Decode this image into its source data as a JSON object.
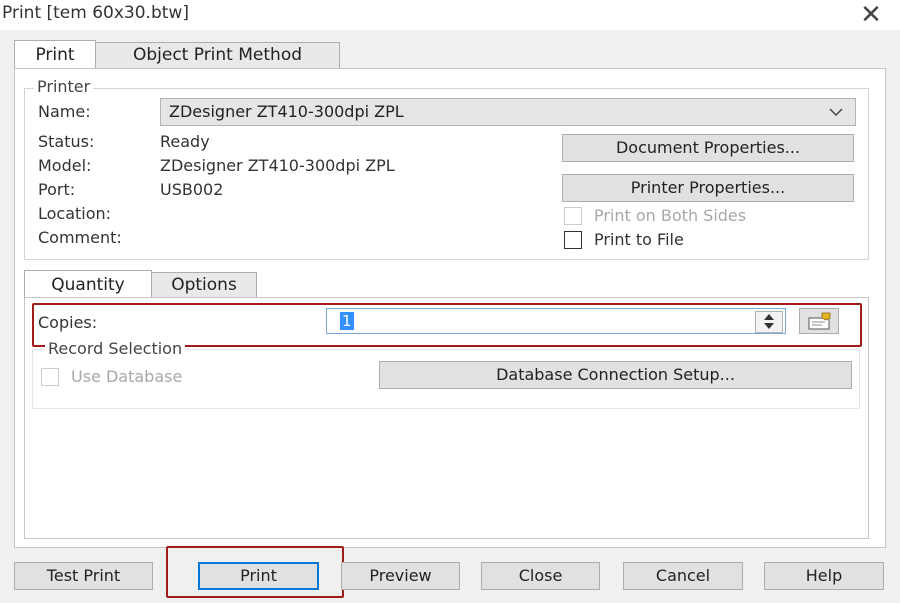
{
  "window": {
    "title": "Print [tem 60x30.btw]",
    "close_glyph": "✕"
  },
  "main_tabs": [
    {
      "label": "Print",
      "active": true
    },
    {
      "label": "Object Print Method",
      "active": false
    }
  ],
  "printer": {
    "group_label": "Printer",
    "name_label": "Name:",
    "name_value": "ZDesigner ZT410-300dpi ZPL",
    "status_label": "Status:",
    "status_value": "Ready",
    "model_label": "Model:",
    "model_value": "ZDesigner ZT410-300dpi ZPL",
    "port_label": "Port:",
    "port_value": "USB002",
    "location_label": "Location:",
    "comment_label": "Comment:",
    "document_properties_label": "Document Properties...",
    "printer_properties_label": "Printer Properties...",
    "print_both_sides_label": "Print on Both Sides",
    "print_to_file_label": "Print to File"
  },
  "sub_tabs": [
    {
      "label": "Quantity",
      "active": true
    },
    {
      "label": "Options",
      "active": false
    }
  ],
  "quantity": {
    "copies_label": "Copies:",
    "copies_value": "1",
    "record_selection_label": "Record Selection",
    "use_database_label": "Use Database",
    "db_connection_label": "Database Connection Setup..."
  },
  "footer_buttons": {
    "test_print": "Test Print",
    "print": "Print",
    "preview": "Preview",
    "close": "Close",
    "cancel": "Cancel",
    "help": "Help"
  },
  "colors": {
    "highlight": "#a31c1c",
    "focus": "#0078d7"
  },
  "icons": [
    "chevron-down-icon",
    "spinner-up-icon",
    "spinner-down-icon",
    "prompt-icon",
    "close-icon"
  ]
}
